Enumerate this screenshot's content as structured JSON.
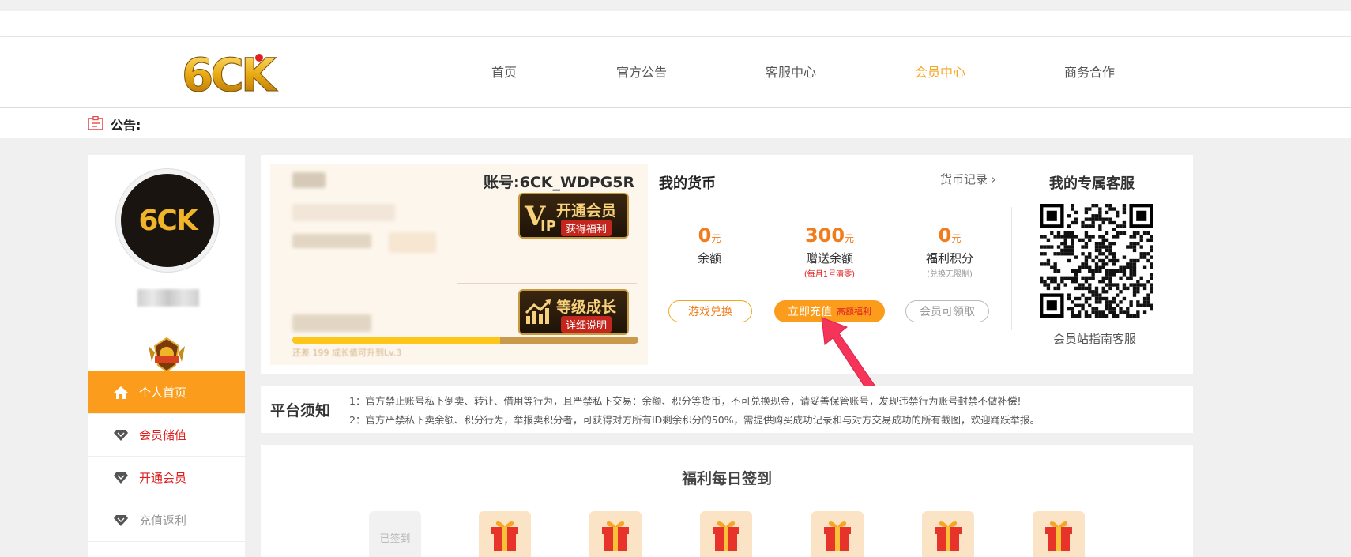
{
  "header": {
    "logo_text": "6CK",
    "nav": [
      {
        "label": "首页",
        "active": false
      },
      {
        "label": "官方公告",
        "active": false
      },
      {
        "label": "客服中心",
        "active": false
      },
      {
        "label": "会员中心",
        "active": true
      },
      {
        "label": "商务合作",
        "active": false
      }
    ],
    "accent_color": "#f5a623"
  },
  "notice": {
    "label": "公告:"
  },
  "sidebar": {
    "avatar_text": "6CK",
    "rank_badge": "黄金",
    "items": [
      {
        "label": "个人首页",
        "icon": "home-icon",
        "active": true
      },
      {
        "label": "会员储值",
        "icon": "diamond-icon",
        "active": false
      },
      {
        "label": "开通会员",
        "icon": "diamond-icon",
        "active": false
      },
      {
        "label": "充值返利",
        "icon": "diamond-icon",
        "active": false
      }
    ]
  },
  "user": {
    "account": "账号:6CK_WDPG5R",
    "vip_button": {
      "title": "开通会员",
      "subtitle": "获得福利"
    },
    "growth_button": {
      "title": "等级成长",
      "subtitle": "详细说明"
    },
    "progress_fraction": 0.6,
    "progress_tip": "还差 199 成长值可升到Lv.3"
  },
  "coins": {
    "title": "我的货币",
    "record_link": "货币记录",
    "unit": "元",
    "balance": {
      "value": "0",
      "label": "余额"
    },
    "bonus": {
      "value": "300",
      "label": "赠送余额",
      "note": "(每月1号清零)"
    },
    "points": {
      "value": "0",
      "label": "福利积分",
      "note": "(兑换无限制)"
    },
    "buttons": {
      "game_exchange": "游戏兑换",
      "recharge": "立即充值",
      "recharge_tag": "高额福利",
      "vip_claim": "会员可领取"
    }
  },
  "service": {
    "title": "我的专属客服",
    "caption": "会员站指南客服"
  },
  "rules": {
    "title": "平台须知",
    "lines": [
      "1：官方禁止账号私下倒卖、转让、借用等行为，且严禁私下交易：余额、积分等货币，不可兑换现金，请妥善保管账号，发现违禁行为账号封禁不做补偿!",
      "2：官方严禁私下卖余额、积分行为，举报卖积分者，可获得对方所有ID剩余积分的50%，需提供购买成功记录和与对方交易成功的所有截图，欢迎踊跃举报。"
    ]
  },
  "signin": {
    "title": "福利每日签到",
    "done_label": "已签到"
  }
}
